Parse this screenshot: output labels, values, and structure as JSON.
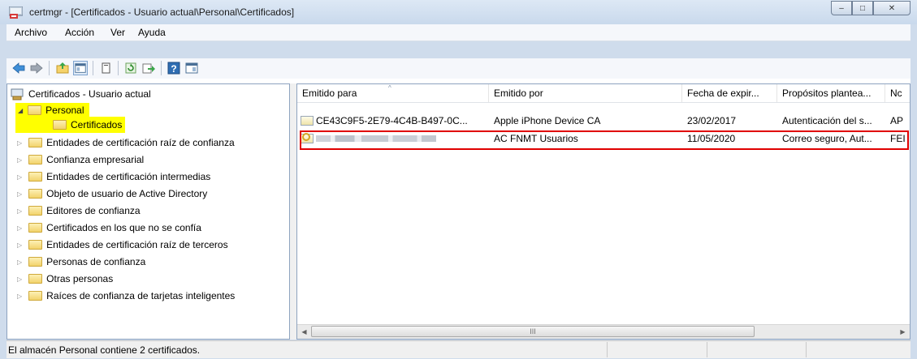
{
  "window": {
    "title": "certmgr - [Certificados - Usuario actual\\Personal\\Certificados]",
    "minimize_glyph": "–",
    "maximize_glyph": "□",
    "close_glyph": "✕"
  },
  "menu": [
    "Archivo",
    "Acción",
    "Ver",
    "Ayuda"
  ],
  "toolbar": {
    "icons": [
      "back-icon",
      "forward-icon",
      "up-folder-icon",
      "show-hide-tree-icon",
      "copy-icon",
      "refresh-icon",
      "export-icon",
      "help-icon",
      "show-hide-action-pane-icon"
    ]
  },
  "tree": {
    "root": "Certificados - Usuario actual",
    "items": [
      {
        "label": "Personal",
        "expanded": true,
        "highlighted": true
      },
      {
        "label": "Certificados",
        "child": true,
        "highlighted": true,
        "selected": true
      },
      {
        "label": "Entidades de certificación raíz de confianza"
      },
      {
        "label": "Confianza empresarial"
      },
      {
        "label": "Entidades de certificación intermedias"
      },
      {
        "label": "Objeto de usuario de Active Directory"
      },
      {
        "label": "Editores de confianza"
      },
      {
        "label": "Certificados en los que no se confía"
      },
      {
        "label": "Entidades de certificación raíz de terceros"
      },
      {
        "label": "Personas de confianza"
      },
      {
        "label": "Otras personas"
      },
      {
        "label": "Raíces de confianza de tarjetas inteligentes"
      }
    ]
  },
  "list": {
    "columns": [
      "Emitido para",
      "Emitido por",
      "Fecha de expir...",
      "Propósitos plantea...",
      "Nc"
    ],
    "rows": [
      {
        "issued_to": "CE43C9F5-2E79-4C4B-B497-0C...",
        "issued_by": "Apple iPhone Device CA",
        "expires": "23/02/2017",
        "purposes": "Autenticación del s...",
        "name": "AP"
      },
      {
        "issued_to": "",
        "issued_to_redacted": true,
        "issued_by": "AC FNMT Usuarios",
        "expires": "11/05/2020",
        "purposes": "Correo seguro, Aut...",
        "name": "FEI"
      }
    ],
    "scroll_glyph": "III"
  },
  "status": {
    "text": "El almacén Personal contiene 2 certificados."
  },
  "colors": {
    "highlight": "#ffff00",
    "annotation_box": "#e00000",
    "title_bar": "#cfdcec"
  }
}
